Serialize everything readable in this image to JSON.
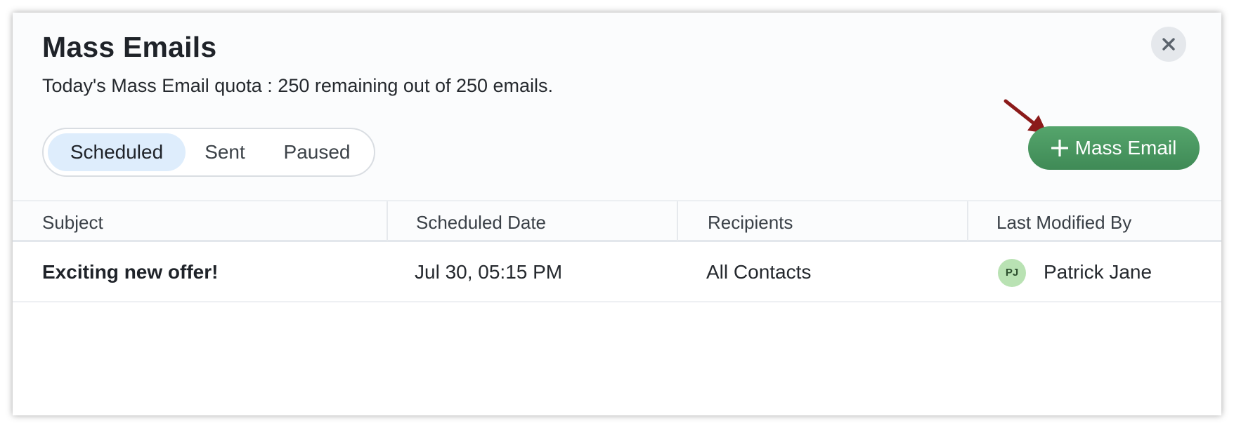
{
  "dialog": {
    "title": "Mass Emails",
    "quota_text": "Today's Mass Email quota : 250 remaining out of 250 emails.",
    "close_icon": "close-icon"
  },
  "tabs": [
    {
      "label": "Scheduled",
      "active": true
    },
    {
      "label": "Sent",
      "active": false
    },
    {
      "label": "Paused",
      "active": false
    }
  ],
  "actions": {
    "mass_email_label": "Mass Email",
    "mass_email_icon": "plus-icon",
    "button_color": "#4c9a63",
    "annotation_arrow_color": "#8b1a1a"
  },
  "table": {
    "columns": [
      "Subject",
      "Scheduled Date",
      "Recipients",
      "Last Modified By"
    ],
    "rows": [
      {
        "subject": "Exciting new offer!",
        "scheduled_date": "Jul 30, 05:15 PM",
        "recipients": "All Contacts",
        "modified_by_initials": "PJ",
        "modified_by_name": "Patrick Jane"
      }
    ]
  }
}
